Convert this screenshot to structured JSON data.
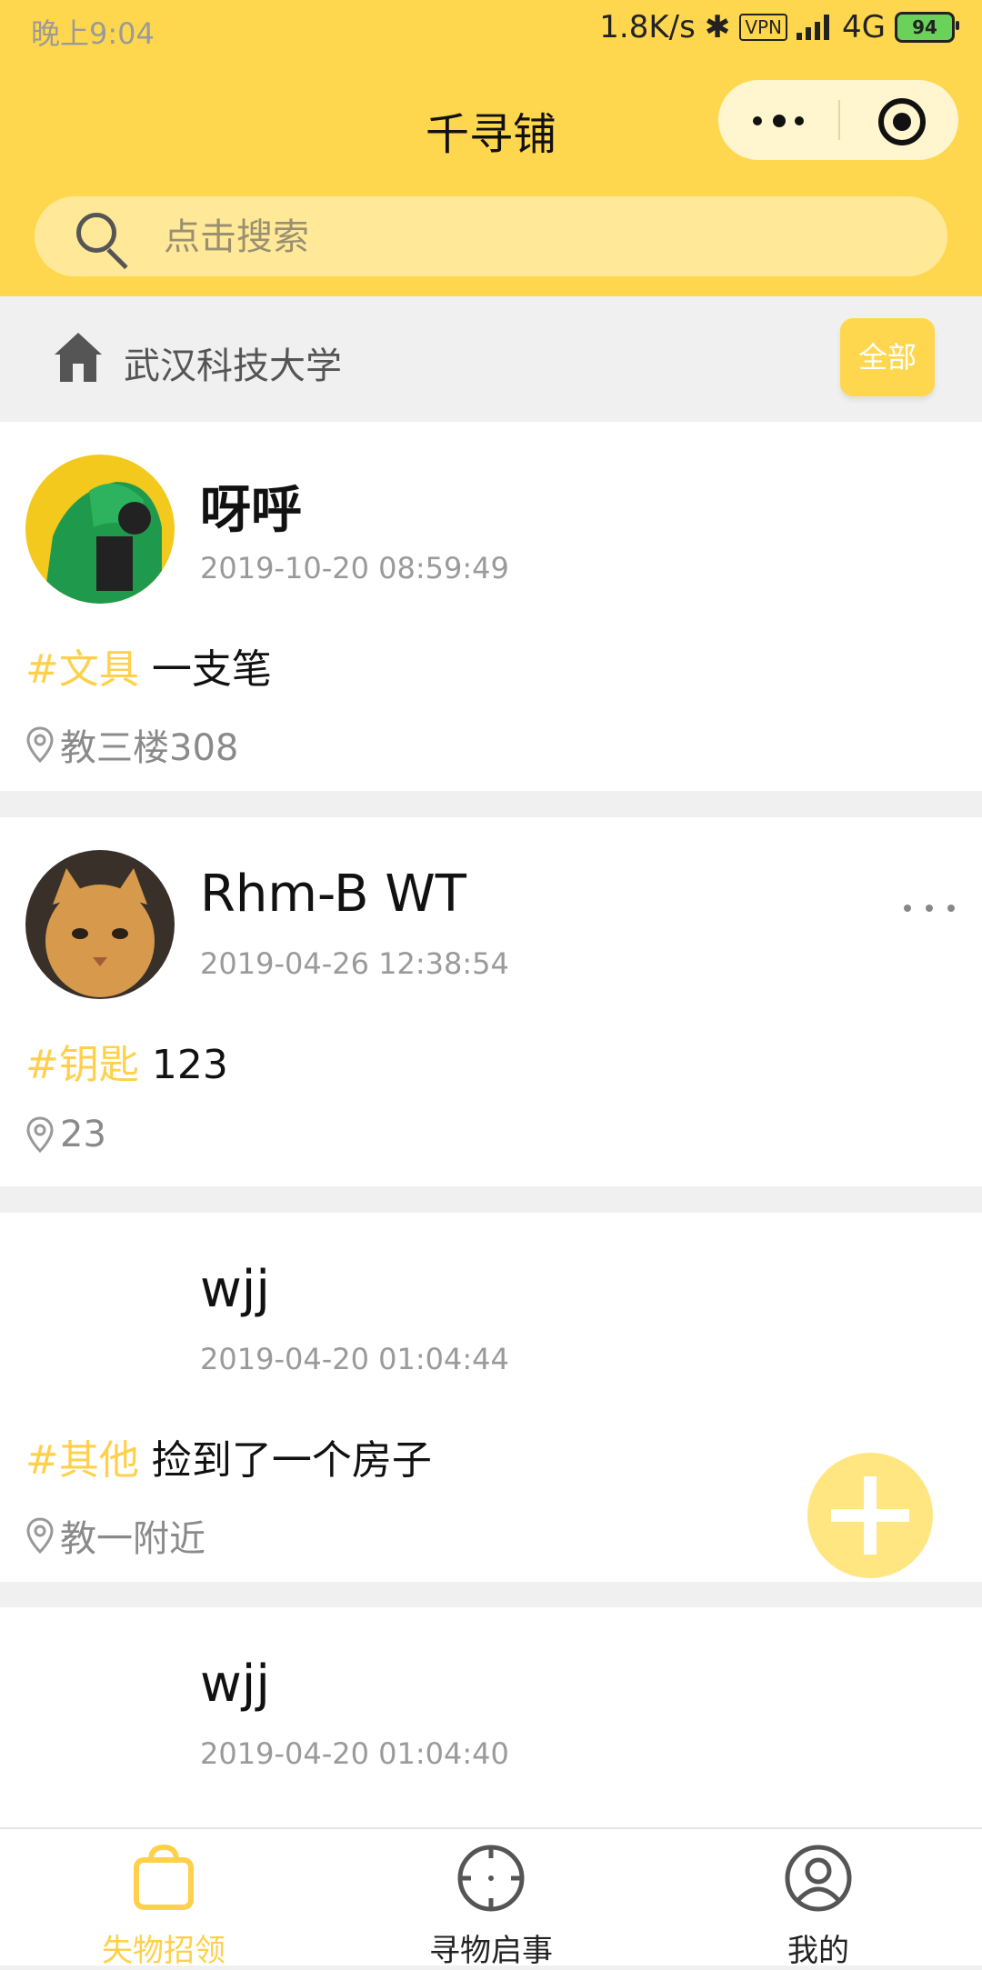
{
  "status": {
    "time": "晚上9:04",
    "speed": "1.8K/s",
    "vpn": "VPN",
    "network": "4G",
    "battery": "94"
  },
  "header": {
    "title": "千寻铺"
  },
  "search": {
    "placeholder": "点击搜索"
  },
  "school": {
    "name": "武汉科技大学",
    "filter_label": "全部"
  },
  "posts": [
    {
      "user": "呀呼",
      "time": "2019-10-20 08:59:49",
      "tag": "#文具",
      "text": "一支笔",
      "location": "教三楼308"
    },
    {
      "user": "Rhm-B WT",
      "time": "2019-04-26 12:38:54",
      "tag": "#钥匙",
      "text": "123",
      "location": "23"
    },
    {
      "user": "wjj",
      "time": "2019-04-20 01:04:44",
      "tag": "#其他",
      "text": "捡到了一个房子",
      "location": "教一附近"
    },
    {
      "user": "wjj",
      "time": "2019-04-20 01:04:40"
    }
  ],
  "tabs": [
    {
      "label": "失物招领",
      "icon": "bag-icon",
      "active": true
    },
    {
      "label": "寻物启事",
      "icon": "crosshair-icon",
      "active": false
    },
    {
      "label": "我的",
      "icon": "user-icon",
      "active": false
    }
  ],
  "colors": {
    "accent": "#ffd74e",
    "tag": "#ffd04a"
  }
}
